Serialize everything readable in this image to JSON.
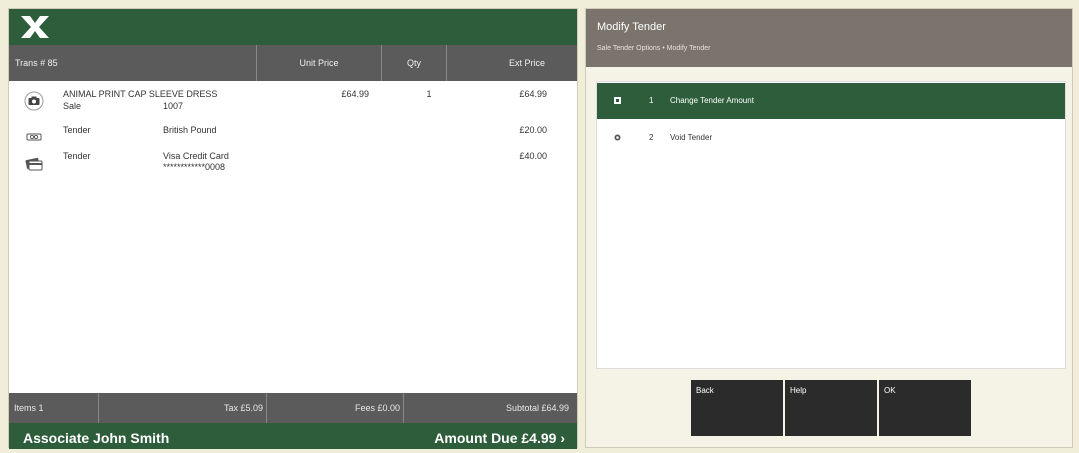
{
  "transaction": {
    "trans_label": "Trans # 85",
    "columns": {
      "unit_price": "Unit Price",
      "qty": "Qty",
      "ext_price": "Ext Price"
    },
    "lines": [
      {
        "icon": "camera-icon",
        "line1": "ANIMAL PRINT CAP SLEEVE DRESS",
        "type": "Sale",
        "detail": "1007",
        "detail2": "",
        "unit_price": "£64.99",
        "qty": "1",
        "ext_price": "£64.99"
      },
      {
        "icon": "cash-icon",
        "line1": "",
        "type": "Tender",
        "detail": "British Pound",
        "detail2": "",
        "unit_price": "",
        "qty": "",
        "ext_price": "£20.00"
      },
      {
        "icon": "credit-card-icon",
        "line1": "",
        "type": "Tender",
        "detail": "Visa Credit Card",
        "detail2": "************0008",
        "unit_price": "",
        "qty": "",
        "ext_price": "£40.00"
      }
    ]
  },
  "totals": {
    "items": "Items 1",
    "tax": "Tax £5.09",
    "fees": "Fees £0.00",
    "subtotal": "Subtotal £64.99"
  },
  "footer": {
    "associate": "Associate John Smith",
    "amount_due": "Amount Due  £4.99 ›"
  },
  "modify_tender": {
    "title": "Modify Tender",
    "breadcrumb": "Sale Tender Options  •  Modify Tender",
    "options": [
      {
        "num": "1",
        "label": "Change Tender Amount",
        "selected": true
      },
      {
        "num": "2",
        "label": "Void Tender",
        "selected": false
      }
    ],
    "buttons": {
      "back": "Back",
      "help": "Help",
      "ok": "OK"
    }
  },
  "colors": {
    "brand_green": "#2e5d3b",
    "header_gray": "#5b5b5b",
    "panel_taupe": "#7b746c",
    "key_black": "#2b2b2b",
    "background": "#f0edd8"
  }
}
